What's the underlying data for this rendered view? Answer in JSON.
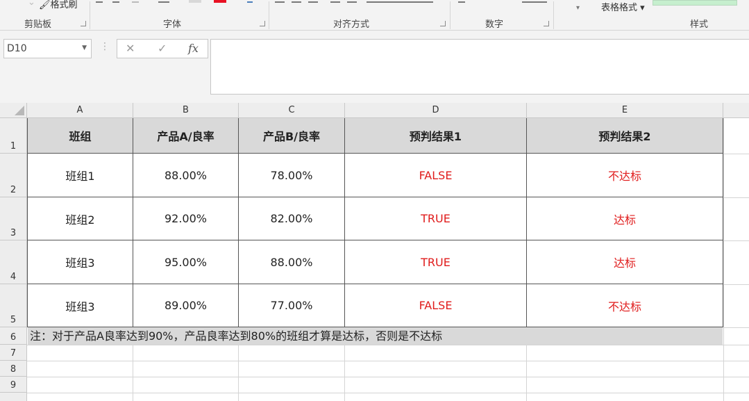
{
  "ribbon": {
    "format_painter": "格式刷",
    "table_format": "表格格式",
    "groups": [
      "剪贴板",
      "字体",
      "对齐方式",
      "数字",
      "样式"
    ]
  },
  "formula_bar": {
    "name_box": "D10",
    "formula": ""
  },
  "sheet": {
    "columns": [
      "A",
      "B",
      "C",
      "D",
      "E"
    ],
    "row_numbers": [
      "1",
      "2",
      "3",
      "4",
      "5",
      "6",
      "7",
      "8",
      "9"
    ],
    "header": [
      "班组",
      "产品A/良率",
      "产品B/良率",
      "预判结果1",
      "预判结果2"
    ],
    "rows": [
      [
        "班组1",
        "88.00%",
        "78.00%",
        "FALSE",
        "不达标"
      ],
      [
        "班组2",
        "92.00%",
        "82.00%",
        "TRUE",
        "达标"
      ],
      [
        "班组3",
        "95.00%",
        "88.00%",
        "TRUE",
        "达标"
      ],
      [
        "班组3",
        "89.00%",
        "77.00%",
        "FALSE",
        "不达标"
      ]
    ],
    "note": "注：对于产品A良率达到90%，产品良率达到80%的班组才算是达标，否则是不达标"
  },
  "colors": {
    "result_text": "#e01b1b",
    "header_fill": "#d9d9d9",
    "ribbon_bg": "#f3f3f3"
  }
}
